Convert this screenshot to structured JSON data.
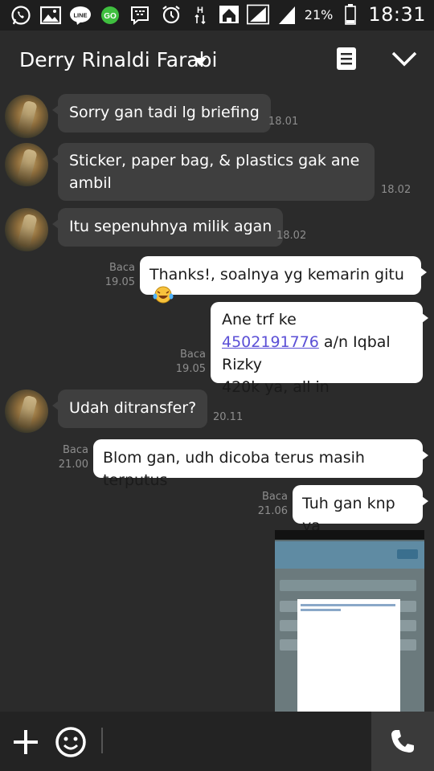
{
  "status_bar": {
    "icons": [
      "whatsapp-icon",
      "gallery-icon",
      "line-icon",
      "go-sms-icon",
      "bbm-icon"
    ],
    "right_icons": [
      "alarm-icon",
      "hspa-data-icon",
      "home-icon",
      "signal-icon",
      "signal-2-icon"
    ],
    "battery_percent": "21%",
    "time": "18:31"
  },
  "header": {
    "title": "Derry Rinaldi Farabi",
    "icons": [
      "chevron-down-icon",
      "notes-icon",
      "collapse-icon"
    ]
  },
  "messages": [
    {
      "direction": "in",
      "text": "Sorry gan tadi lg briefing",
      "time": "18.01"
    },
    {
      "direction": "in",
      "text": "Sticker, paper bag, & plastics gak ane ambil",
      "time": "18.02"
    },
    {
      "direction": "in",
      "text": "Itu sepenuhnya milik agan",
      "time": "18.02"
    },
    {
      "direction": "out",
      "text": "Thanks!, soalnya yg kemarin gitu",
      "emoji": "laughing-crying-emoji",
      "read": "Baca",
      "time": "19.05"
    },
    {
      "direction": "out",
      "line1": "Ane trf ke",
      "link": "4502191776",
      "line2_rest": " a/n Iqbal Rizky",
      "line3": "420k ya, all in",
      "read": "Baca",
      "time": "19.05"
    },
    {
      "direction": "in",
      "text": "Udah ditransfer?",
      "time": "20.11"
    },
    {
      "direction": "out",
      "text": "Blom gan, udh dicoba terus masih terputus",
      "read": "Baca",
      "time": "21.00"
    },
    {
      "direction": "out",
      "text": "Tuh gan knp ya",
      "read": "Baca",
      "time": "21.06"
    }
  ],
  "screenshot_image": {
    "description_icon": "screenshot-thumbnail"
  },
  "input_bar": {
    "placeholder": "",
    "icons": [
      "plus-icon",
      "smiley-icon",
      "phone-icon"
    ]
  },
  "colors": {
    "background": "#2b2b2b",
    "incoming_bubble": "#3f3f3f",
    "outgoing_bubble": "#ffffff",
    "link": "#5b4fd6",
    "meta_text": "#8d8d8d"
  }
}
